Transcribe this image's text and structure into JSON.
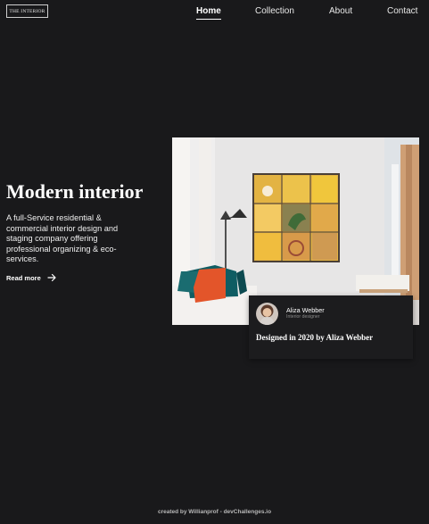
{
  "brand": {
    "logo_text": "THE INTERIOR"
  },
  "nav": {
    "items": [
      {
        "label": "Home",
        "active": true
      },
      {
        "label": "Collection",
        "active": false
      },
      {
        "label": "About",
        "active": false
      },
      {
        "label": "Contact",
        "active": false
      }
    ]
  },
  "hero": {
    "title": "Modern interior",
    "description": "A full-Service residential & commercial interior design and staging company offering professional organizing & eco-services.",
    "cta_label": "Read more",
    "cta_icon": "arrow-right-icon"
  },
  "showcase": {
    "image": "living-room-photo",
    "designer_name": "Aliza Webber",
    "designer_role": "Interior designer",
    "caption": "Designed in 2020 by Aliza Webber"
  },
  "footer": {
    "credit": "created by Willianprof - devChallenges.io"
  },
  "colors": {
    "background": "#19191b",
    "text": "#ffffff",
    "muted": "#8b8b8b",
    "card": "#1c1c1e"
  }
}
